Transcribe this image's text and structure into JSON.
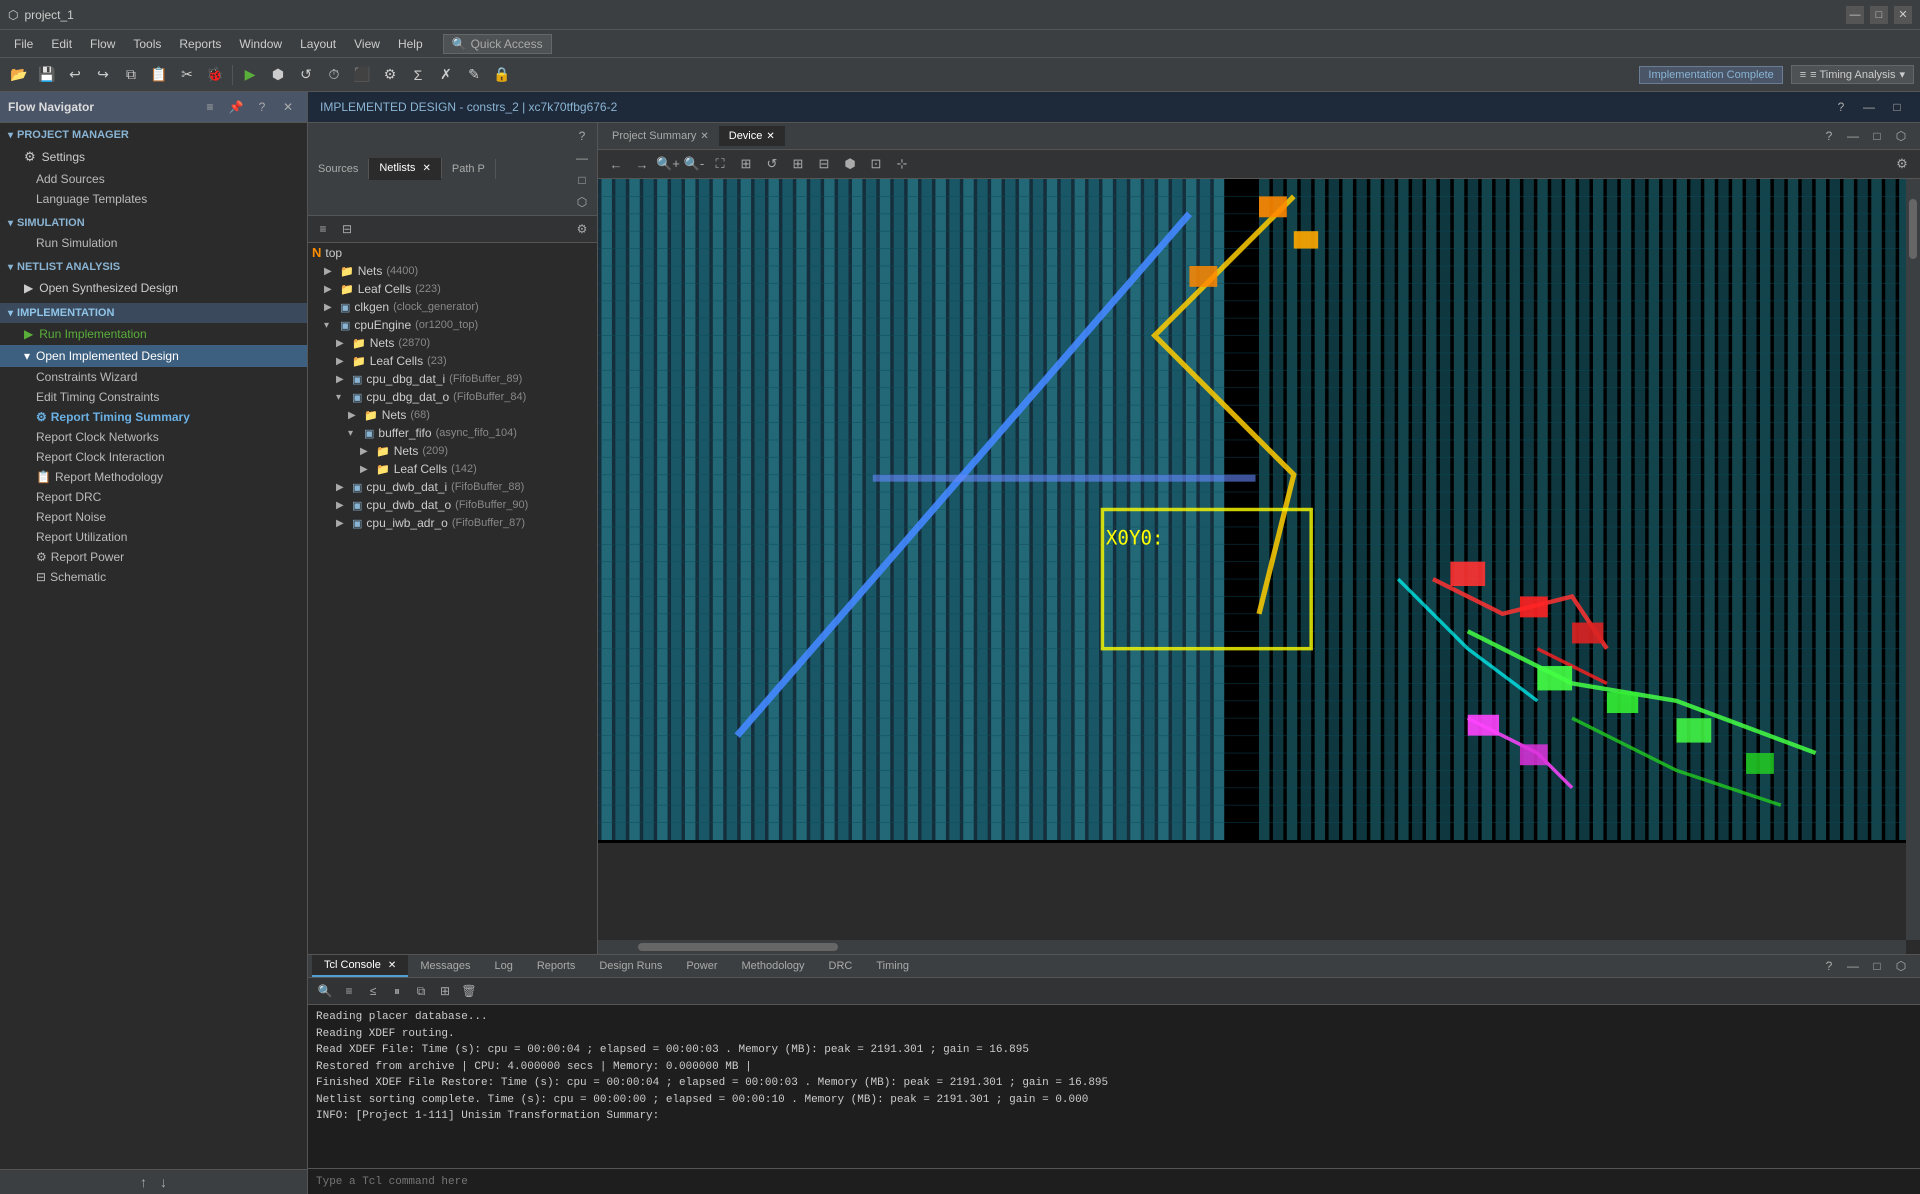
{
  "titleBar": {
    "title": "project_1",
    "icon": "⬡",
    "controls": {
      "minimize": "—",
      "maximize": "□",
      "close": "✕"
    }
  },
  "menuBar": {
    "items": [
      "File",
      "Edit",
      "Flow",
      "Tools",
      "Reports",
      "Window",
      "Layout",
      "View",
      "Help"
    ],
    "quickAccess": {
      "icon": "🔍",
      "label": "Quick Access"
    }
  },
  "implComplete": {
    "label": "Implementation Complete",
    "timingLabel": "≡ Timing Analysis",
    "dropdownArrow": "▾"
  },
  "flowNavigator": {
    "title": "Flow Navigator",
    "sections": [
      {
        "id": "project-manager",
        "label": "PROJECT MANAGER",
        "items": [
          {
            "id": "settings",
            "label": "Settings",
            "icon": "⚙"
          },
          {
            "id": "add-sources",
            "label": "Add Sources"
          },
          {
            "id": "lang-templates",
            "label": "Language Templates"
          }
        ]
      },
      {
        "id": "simulation",
        "label": "SIMULATION",
        "items": [
          {
            "id": "run-simulation",
            "label": "Run Simulation"
          }
        ]
      },
      {
        "id": "netlist",
        "label": "NETLIST ANALYSIS",
        "items": [
          {
            "id": "open-synth",
            "label": "Open Synthesized Design",
            "arrow": "▶"
          }
        ]
      },
      {
        "id": "implementation",
        "label": "IMPLEMENTATION",
        "items": [
          {
            "id": "run-impl",
            "label": "Run Implementation",
            "icon": "▶",
            "color": "green"
          },
          {
            "id": "open-impl",
            "label": "Open Implemented Design",
            "expanded": true,
            "icon": "▾"
          },
          {
            "id": "constraints-wizard",
            "label": "Constraints Wizard",
            "indent": true
          },
          {
            "id": "edit-timing",
            "label": "Edit Timing Constraints",
            "indent": true
          },
          {
            "id": "report-timing-summary",
            "label": "Report Timing Summary",
            "indent": true,
            "icon": "⚙"
          },
          {
            "id": "report-clock-networks",
            "label": "Report Clock Networks",
            "indent": true
          },
          {
            "id": "report-clock-interaction",
            "label": "Report Clock Interaction",
            "indent": true
          },
          {
            "id": "report-methodology",
            "label": "Report Methodology",
            "indent": true,
            "icon": "📋"
          },
          {
            "id": "report-drc",
            "label": "Report DRC",
            "indent": true
          },
          {
            "id": "report-noise",
            "label": "Report Noise",
            "indent": true
          },
          {
            "id": "report-utilization",
            "label": "Report Utilization",
            "indent": true
          },
          {
            "id": "report-power",
            "label": "Report Power",
            "indent": true,
            "icon": "⚙"
          },
          {
            "id": "schematic",
            "label": "Schematic",
            "indent": true,
            "icon": "⊟"
          }
        ]
      }
    ]
  },
  "implDesignHeader": {
    "label": "IMPLEMENTED DESIGN",
    "separator": " - ",
    "constraint": "constrs_2",
    "separator2": " | ",
    "part": "xc7k70tfbg676-2",
    "helpIcon": "?",
    "minimizeIcon": "—",
    "maximizeIcon": "□"
  },
  "sourcesTabs": [
    {
      "label": "Sources",
      "active": false
    },
    {
      "label": "Netlists",
      "active": true,
      "closable": true
    },
    {
      "label": "Path P",
      "active": false
    }
  ],
  "sourcesToolbar": {
    "buttons": [
      "≡",
      "⊟",
      "≤",
      "?"
    ]
  },
  "treeData": {
    "root": "top",
    "rootIcon": "N",
    "items": [
      {
        "indent": 1,
        "arrow": "▶",
        "icon": "folder",
        "label": "Nets",
        "count": "(4400)"
      },
      {
        "indent": 1,
        "arrow": "▶",
        "icon": "folder",
        "label": "Leaf Cells",
        "count": "(223)"
      },
      {
        "indent": 1,
        "arrow": "▶",
        "icon": "cell",
        "label": "clkgen",
        "detail": "(clock_generator)"
      },
      {
        "indent": 1,
        "arrow": "▾",
        "icon": "cell",
        "label": "cpuEngine",
        "detail": "(or1200_top)"
      },
      {
        "indent": 2,
        "arrow": "▶",
        "icon": "folder",
        "label": "Nets",
        "count": "(2870)"
      },
      {
        "indent": 2,
        "arrow": "▶",
        "icon": "folder",
        "label": "Leaf Cells",
        "count": "(23)"
      },
      {
        "indent": 2,
        "arrow": "▶",
        "icon": "cell",
        "label": "cpu_dbg_dat_i",
        "detail": "(FifoBuffer_89)"
      },
      {
        "indent": 2,
        "arrow": "▾",
        "icon": "cell",
        "label": "cpu_dbg_dat_o",
        "detail": "(FifoBuffer_84)"
      },
      {
        "indent": 3,
        "arrow": "▶",
        "icon": "folder",
        "label": "Nets",
        "count": "(68)"
      },
      {
        "indent": 3,
        "arrow": "▾",
        "icon": "cell",
        "label": "buffer_fifo",
        "detail": "(async_fifo_104)"
      },
      {
        "indent": 4,
        "arrow": "▶",
        "icon": "folder",
        "label": "Nets",
        "count": "(209)"
      },
      {
        "indent": 4,
        "arrow": "▶",
        "icon": "folder",
        "label": "Leaf Cells",
        "count": "(142)"
      },
      {
        "indent": 2,
        "arrow": "▶",
        "icon": "cell",
        "label": "cpu_dwb_dat_i",
        "detail": "(FifoBuffer_88)"
      },
      {
        "indent": 2,
        "arrow": "▶",
        "icon": "cell",
        "label": "cpu_dwb_dat_o",
        "detail": "(FifoBuffer_90)"
      },
      {
        "indent": 2,
        "arrow": "▶",
        "icon": "cell",
        "label": "cpu_iwb_adr_o",
        "detail": "(FifoBuffer_87)"
      }
    ]
  },
  "deviceTabs": [
    {
      "label": "Project Summary",
      "active": false,
      "closable": true
    },
    {
      "label": "Device",
      "active": true,
      "closable": true
    }
  ],
  "bottomPanel": {
    "tabs": [
      {
        "label": "Tcl Console",
        "active": true,
        "closable": true
      },
      {
        "label": "Messages",
        "active": false
      },
      {
        "label": "Log",
        "active": false
      },
      {
        "label": "Reports",
        "active": false
      },
      {
        "label": "Design Runs",
        "active": false
      },
      {
        "label": "Power",
        "active": false
      },
      {
        "label": "Methodology",
        "active": false
      },
      {
        "label": "DRC",
        "active": false
      },
      {
        "label": "Timing",
        "active": false
      }
    ],
    "consoleLines": [
      "Reading placer database...",
      "Reading XDEF routing.",
      "Read XDEF File: Time (s): cpu = 00:00:04 ; elapsed = 00:00:03 . Memory (MB): peak = 2191.301 ; gain = 16.895",
      "Restored from archive | CPU: 4.000000 secs | Memory: 0.000000 MB |",
      "Finished XDEF File Restore: Time (s): cpu = 00:00:04 ; elapsed = 00:00:03 . Memory (MB): peak = 2191.301 ; gain = 16.895",
      "Netlist sorting complete. Time (s): cpu = 00:00:00 ; elapsed = 00:00:10 . Memory (MB): peak = 2191.301 ; gain = 0.000",
      "INFO: [Project 1-111] Unisim Transformation Summary:"
    ],
    "inputPlaceholder": "Type a Tcl command here"
  },
  "coords": {
    "display": "X0Y0:"
  }
}
